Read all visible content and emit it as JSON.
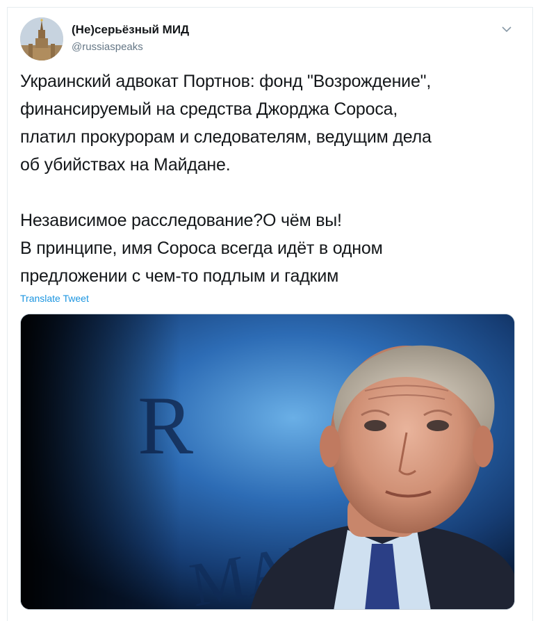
{
  "account": {
    "name": "(Не)серьёзный МИД",
    "handle": "@russiaspeaks"
  },
  "tweet": {
    "paragraph1": [
      "Украинский адвокат Портнов: фонд \"Возрождение\",",
      "финансируемый на средства Джорджа Сороса,",
      "платил прокурорам и следователям, ведущим дела",
      "об убийствах на Майдане."
    ],
    "paragraph2": [
      "Независимое расследование?О чём вы!",
      "В принципе, имя Сороса всегда идёт в одном",
      "предложении с чем-то подлым и гадким"
    ],
    "translate_label": "Translate Tweet"
  },
  "media": {
    "background_letters": "R",
    "background_word": "MAN"
  },
  "icons": {
    "caret": "chevron-down-icon"
  },
  "colors": {
    "link": "#1b95e0",
    "secondary_text": "#657786",
    "border": "#e6ecf0"
  }
}
